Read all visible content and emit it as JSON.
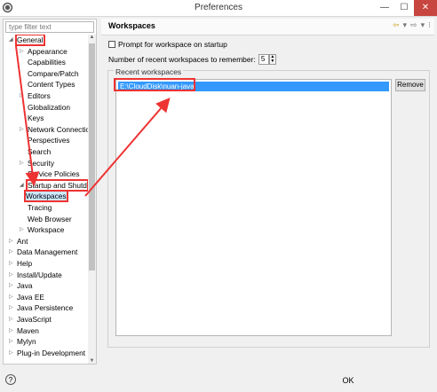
{
  "window": {
    "title": "Preferences",
    "min_icon": "minimize-icon",
    "max_icon": "maximize-icon",
    "close_icon": "close-icon"
  },
  "left": {
    "filter_placeholder": "type filter text",
    "tree": [
      {
        "label": "General",
        "level": 0,
        "expanded": true,
        "highlight": true
      },
      {
        "label": "Appearance",
        "level": 1,
        "twisty": true
      },
      {
        "label": "Capabilities",
        "level": 1
      },
      {
        "label": "Compare/Patch",
        "level": 1
      },
      {
        "label": "Content Types",
        "level": 1
      },
      {
        "label": "Editors",
        "level": 1,
        "twisty": true
      },
      {
        "label": "Globalization",
        "level": 1
      },
      {
        "label": "Keys",
        "level": 1
      },
      {
        "label": "Network Connectio",
        "level": 1,
        "twisty": true
      },
      {
        "label": "Perspectives",
        "level": 1
      },
      {
        "label": "Search",
        "level": 1
      },
      {
        "label": "Security",
        "level": 1,
        "twisty": true
      },
      {
        "label": "Service Policies",
        "level": 1
      },
      {
        "label": "Startup and Shutd",
        "level": 1,
        "expanded": true,
        "highlight": true
      },
      {
        "label": "Workspaces",
        "level": 2,
        "selected": true,
        "highlight": true
      },
      {
        "label": "Tracing",
        "level": 1
      },
      {
        "label": "Web Browser",
        "level": 1
      },
      {
        "label": "Workspace",
        "level": 1,
        "twisty": true
      },
      {
        "label": "Ant",
        "level": 0,
        "twisty": true
      },
      {
        "label": "Data Management",
        "level": 0,
        "twisty": true
      },
      {
        "label": "Help",
        "level": 0,
        "twisty": true
      },
      {
        "label": "Install/Update",
        "level": 0,
        "twisty": true
      },
      {
        "label": "Java",
        "level": 0,
        "twisty": true
      },
      {
        "label": "Java EE",
        "level": 0,
        "twisty": true
      },
      {
        "label": "Java Persistence",
        "level": 0,
        "twisty": true
      },
      {
        "label": "JavaScript",
        "level": 0,
        "twisty": true
      },
      {
        "label": "Maven",
        "level": 0,
        "twisty": true
      },
      {
        "label": "Mylyn",
        "level": 0,
        "twisty": true
      },
      {
        "label": "Plug-in Development",
        "level": 0,
        "twisty": true
      }
    ]
  },
  "right": {
    "title": "Workspaces",
    "prompt_label": "Prompt for workspace on startup",
    "prompt_checked": false,
    "recent_count_label": "Number of recent workspaces to remember:",
    "recent_count_value": "5",
    "group_title": "Recent workspaces",
    "workspaces": [
      "E:\\CloudDisk\\nuan-java"
    ],
    "remove_label": "Remove"
  },
  "bottom": {
    "help_icon": "help-icon",
    "ok_label": "OK"
  },
  "colors": {
    "annotation": "#e33333",
    "selection": "#3399ff"
  }
}
